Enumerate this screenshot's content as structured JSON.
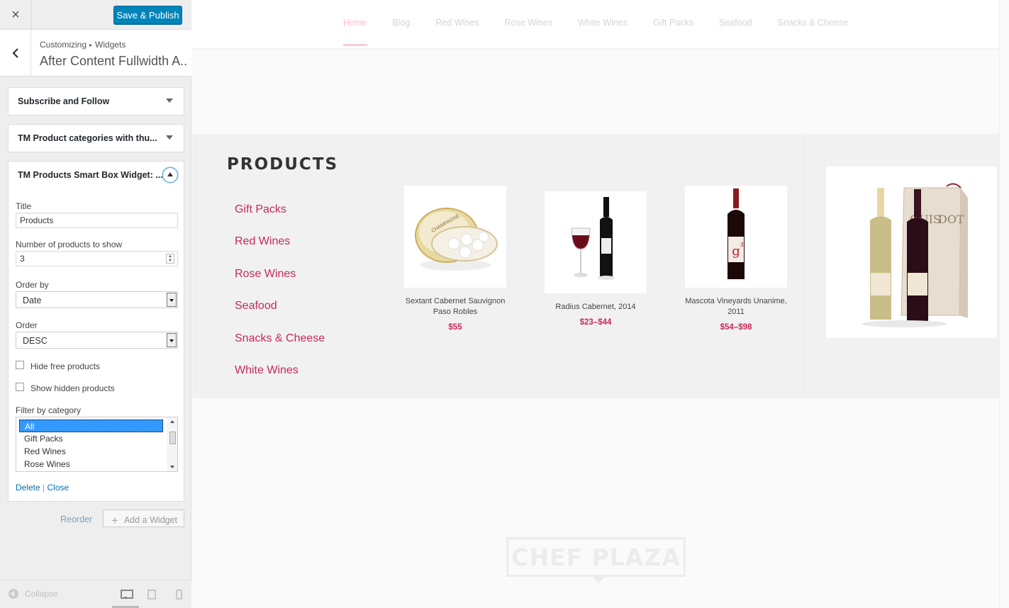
{
  "topbar": {
    "close_label": "×",
    "save_label": "Save & Publish"
  },
  "header": {
    "breadcrumb_root": "Customizing",
    "breadcrumb_sep": "▸",
    "breadcrumb_current": "Widgets",
    "section_title": "After Content Fullwidth A..."
  },
  "widgets": [
    {
      "title": "Subscribe and Follow",
      "expanded": false
    },
    {
      "title": "TM Product categories with thu...",
      "expanded": false
    },
    {
      "title": "TM Products Smart Box Widget: ...",
      "expanded": true
    }
  ],
  "form": {
    "title_label": "Title",
    "title_value": "Products",
    "count_label": "Number of products to show",
    "count_value": "3",
    "orderby_label": "Order by",
    "orderby_value": "Date",
    "order_label": "Order",
    "order_value": "DESC",
    "hide_free_label": "Hide free products",
    "hide_free_checked": false,
    "show_hidden_label": "Show hidden products",
    "show_hidden_checked": false,
    "filter_label": "Filter by category",
    "filter_options": [
      "All",
      "Gift Packs",
      "Red Wines",
      "Rose Wines"
    ],
    "filter_selected": "All",
    "delete_label": "Delete",
    "action_sep": "|",
    "close_label": "Close"
  },
  "panel_actions": {
    "reorder_label": "Reorder",
    "add_widget_label": "Add a Widget",
    "add_icon": "+"
  },
  "footer": {
    "collapse_label": "Collapse",
    "devices": [
      "desktop-icon",
      "tablet-icon",
      "mobile-icon"
    ]
  },
  "preview": {
    "nav": [
      "Home",
      "Blog",
      "Red Wines",
      "Rose Wines",
      "White Wines",
      "Gift Packs",
      "Seafood",
      "Snacks & Cheese"
    ],
    "nav_active": "Home",
    "products_heading": "PRODUCTS",
    "categories": [
      "Gift Packs",
      "Red Wines",
      "Rose Wines",
      "Seafood",
      "Snacks & Cheese",
      "White Wines"
    ],
    "products": [
      {
        "name": "Sextant Cabernet Sauvignon Paso Robles",
        "price": "$55"
      },
      {
        "name": "Radius Cabernet, 2014",
        "price": "$23–$44"
      },
      {
        "name": "Mascota Vineyards Unanime, 2011",
        "price": "$54–$98"
      }
    ],
    "logo_text": "CHEF PLAZA"
  },
  "colors": {
    "accent": "#0085ba",
    "brand_pink": "#c52a58",
    "link": "#0073aa"
  }
}
